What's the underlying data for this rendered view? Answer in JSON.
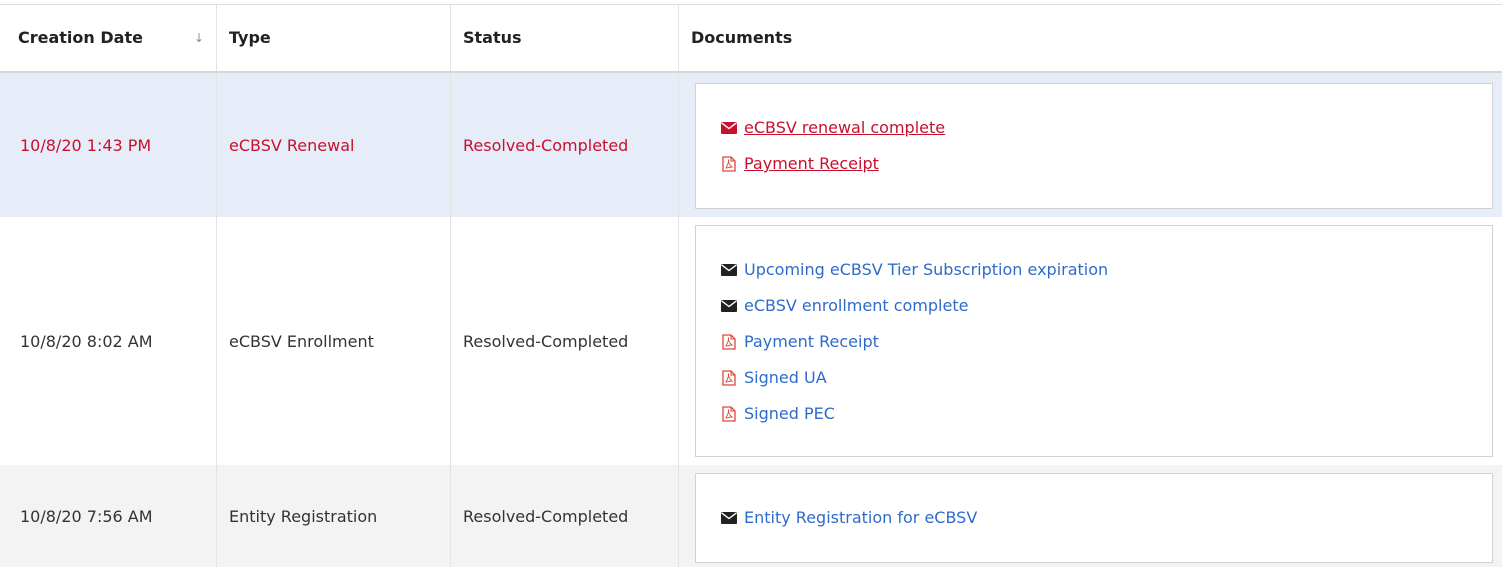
{
  "header": {
    "creation_date": "Creation Date",
    "type": "Type",
    "status": "Status",
    "documents": "Documents",
    "sort_glyph": "↓"
  },
  "rows": [
    {
      "date": "10/8/20 1:43 PM",
      "type": "eCBSV Renewal",
      "status": "Resolved-Completed",
      "docs": [
        {
          "icon": "envelope-icon",
          "label": "eCBSV renewal complete"
        },
        {
          "icon": "pdf-icon",
          "label": "Payment Receipt"
        }
      ]
    },
    {
      "date": "10/8/20 8:02 AM",
      "type": "eCBSV Enrollment",
      "status": "Resolved-Completed",
      "docs": [
        {
          "icon": "envelope-icon",
          "label": "Upcoming eCBSV Tier Subscription expiration"
        },
        {
          "icon": "envelope-icon",
          "label": "eCBSV enrollment complete"
        },
        {
          "icon": "pdf-icon",
          "label": "Payment Receipt"
        },
        {
          "icon": "pdf-icon",
          "label": "Signed UA"
        },
        {
          "icon": "pdf-icon",
          "label": "Signed PEC"
        }
      ]
    },
    {
      "date": "10/8/20 7:56 AM",
      "type": "Entity Registration",
      "status": "Resolved-Completed",
      "docs": [
        {
          "icon": "envelope-icon",
          "label": "Entity Registration for eCBSV"
        }
      ]
    }
  ],
  "colors": {
    "active_text": "#c8102e",
    "link": "#2f6bc9",
    "active_row_bg": "#e7edf8",
    "alt_row_bg": "#f3f3f3",
    "pdf_icon": "#e0453a"
  }
}
